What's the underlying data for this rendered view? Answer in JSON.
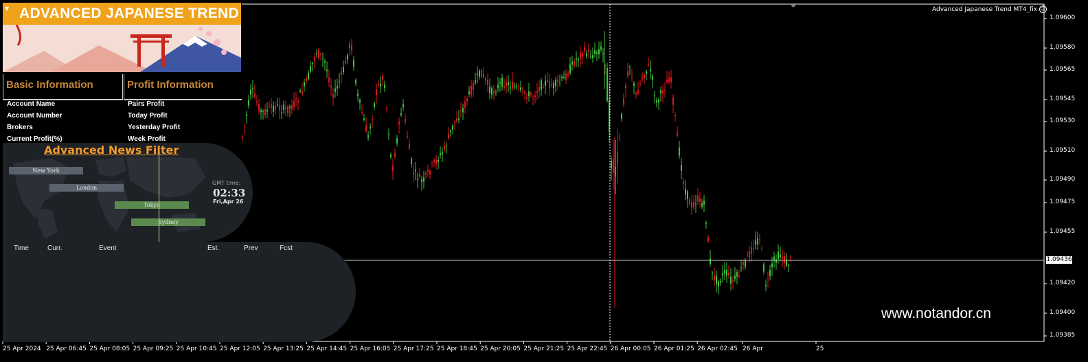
{
  "chart": {
    "indicator_name": "Advanced Japanese Trend MT4_fix",
    "current_price": "1.09436",
    "watermark": "www.notandor.cn",
    "price_labels": [
      "1.09600",
      "1.09580",
      "1.09565",
      "1.09545",
      "1.09530",
      "1.09510",
      "1.09490",
      "1.09475",
      "1.09455",
      "1.09420",
      "1.09400",
      "1.09385"
    ],
    "time_labels": [
      "25 Apr 2024",
      "25 Apr 06:45",
      "25 Apr 08:05",
      "25 Apr 09:25",
      "25 Apr 10:45",
      "25 Apr 12:05",
      "25 Apr 13:25",
      "25 Apr 14:45",
      "25 Apr 16:05",
      "25 Apr 17:25",
      "25 Apr 18:45",
      "25 Apr 20:05",
      "25 Apr 21:25",
      "25 Apr 22:45",
      "26 Apr 00:05",
      "26 Apr 01:25",
      "26 Apr 02:45",
      "26 Apr",
      "25"
    ],
    "colors": {
      "bull": "#3ec53e",
      "bear": "#e0191c",
      "grid": "#ffffff",
      "bg": "#000000"
    }
  },
  "panel": {
    "banner_title": "ADVANCED JAPANESE TREND",
    "basic_title": "Basic Information",
    "profit_title": "Profit Information",
    "basic_items": [
      "Account Name",
      "Account Number",
      "Brokers",
      "Current Profit(%)"
    ],
    "profit_items": [
      "Pairs Profit",
      "Today Profit",
      "Yesterday Profit",
      "Week Profit"
    ],
    "accent": "#f0a21b"
  },
  "news": {
    "title": "Advanced News Filter",
    "sessions": [
      {
        "name": "New York",
        "color": "#5a636d"
      },
      {
        "name": "London",
        "color": "#5a636d"
      },
      {
        "name": "Tokyo",
        "color": "#5a8a4e"
      },
      {
        "name": "Sydney",
        "color": "#5a8a4e"
      }
    ],
    "gmt_label": "GMT time:",
    "gmt_time": "02:33",
    "gmt_date": "Fri,Apr 26",
    "columns": [
      "Time",
      "Curr.",
      "Event",
      "Est.",
      "Prev",
      "Fcst"
    ]
  }
}
